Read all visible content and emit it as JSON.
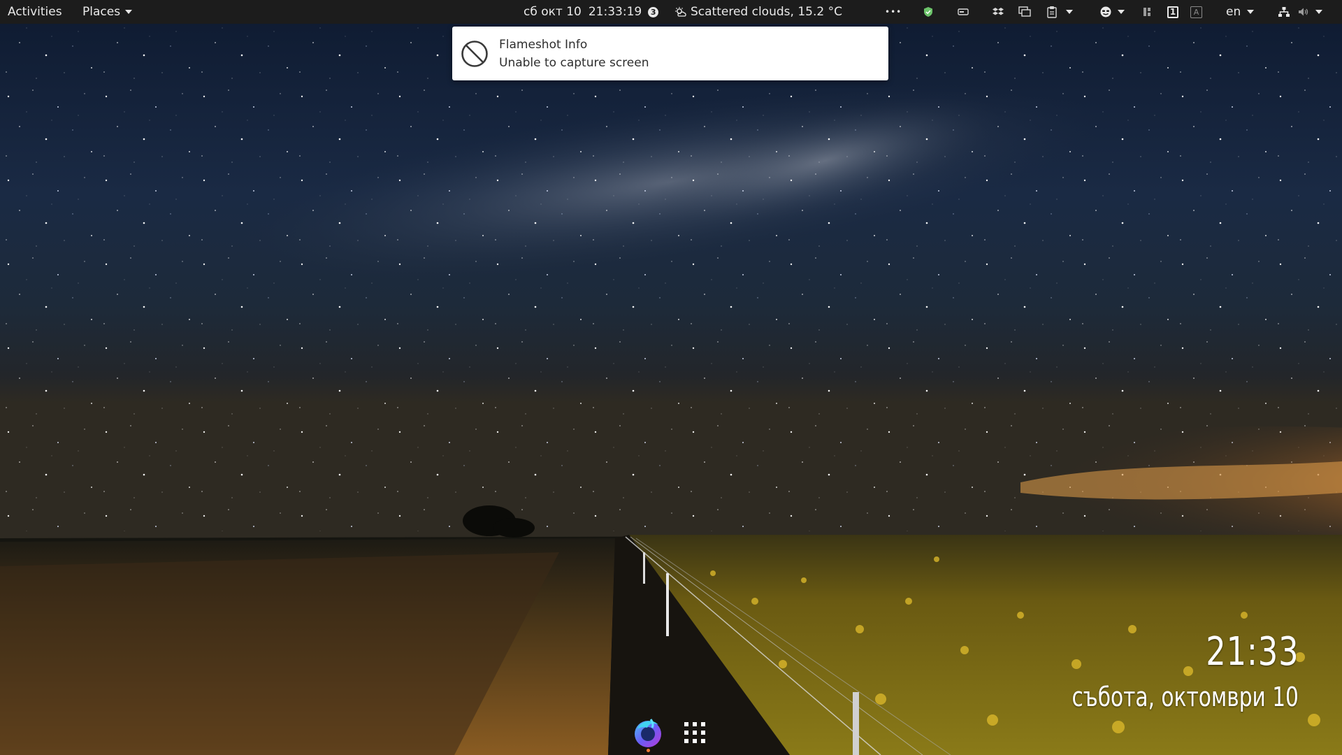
{
  "topbar": {
    "activities_label": "Activities",
    "places_label": "Places",
    "date_label": "сб окт 10",
    "time_label": "21:33:19",
    "notification_count": "3",
    "weather_label": "Scattered clouds, 15.2 °C",
    "overflow_label": "•••",
    "language_label": "en",
    "workspace_number": "1",
    "keyboard_indicator": "A",
    "icons": [
      "notification-count-icon",
      "weather-icon",
      "overflow-menu-icon",
      "shield-icon",
      "drive-icon",
      "dropbox-icon",
      "windows-icon",
      "clipboard-icon",
      "emoji-icon",
      "panel-icon",
      "workspace-icon",
      "keyboard-indicator-icon",
      "network-icon",
      "volume-muted-icon",
      "system-menu-chevron-icon"
    ]
  },
  "notification": {
    "title": "Flameshot Info",
    "body": "Unable to capture screen",
    "icon": "prohibited-icon"
  },
  "desklet": {
    "time": "21:33",
    "date": "събота, октомври 10"
  },
  "dock": {
    "items": [
      "firefox-nightly-icon",
      "show-applications-icon"
    ]
  },
  "colors": {
    "topbar_bg": "#1c1c1c",
    "accent_orange": "#f17a33",
    "notification_bg": "#ffffff"
  }
}
